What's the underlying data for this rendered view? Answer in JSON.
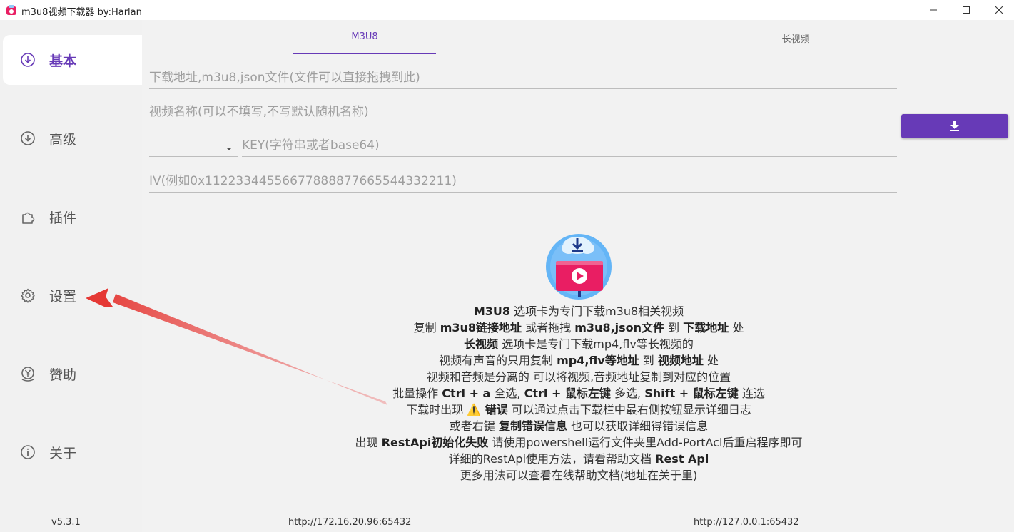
{
  "window": {
    "title": "m3u8视频下载器 by:Harlan",
    "controls": {
      "minimize": "—",
      "maximize": "☐",
      "close": "✕"
    }
  },
  "sidebar": {
    "items": [
      {
        "label": "基本",
        "icon": "download-circle-icon",
        "active": true
      },
      {
        "label": "高级",
        "icon": "download-circle-icon",
        "active": false
      },
      {
        "label": "插件",
        "icon": "puzzle-icon",
        "active": false
      },
      {
        "label": "设置",
        "icon": "gear-icon",
        "active": false
      },
      {
        "label": "赞助",
        "icon": "yen-icon",
        "active": false
      },
      {
        "label": "关于",
        "icon": "info-icon",
        "active": false
      }
    ],
    "version": "v5.3.1"
  },
  "tabs": [
    {
      "label": "M3U8",
      "active": true
    },
    {
      "label": "长视频",
      "active": false
    }
  ],
  "form": {
    "url_placeholder": "下载地址,m3u8,json文件(文件可以直接拖拽到此)",
    "name_placeholder": "视频名称(可以不填写,不写默认随机名称)",
    "method_value": "",
    "key_placeholder": "KEY(字符串或者base64)",
    "iv_placeholder": "IV(例如0x11223344556677888877665544332211)"
  },
  "help": {
    "line1_b": "M3U8",
    "line1_t": " 选项卡为专门下载m3u8相关视频",
    "line2_t1": "复制 ",
    "line2_b1": "m3u8链接地址",
    "line2_t2": " 或者拖拽 ",
    "line2_b2": "m3u8,json文件",
    "line2_t3": " 到 ",
    "line2_b3": "下载地址",
    "line2_t4": " 处",
    "line3_b": "长视频",
    "line3_t": " 选项卡是专门下载mp4,flv等长视频的",
    "line4_t1": "视频有声音的只用复制 ",
    "line4_b1": "mp4,flv等地址",
    "line4_t2": " 到 ",
    "line4_b2": "视频地址",
    "line4_t3": " 处",
    "line5": "视频和音频是分离的 可以将视频,音频地址复制到对应的位置",
    "line6_t1": "批量操作 ",
    "line6_b1": "Ctrl + a",
    "line6_t2": " 全选, ",
    "line6_b2": "Ctrl + 鼠标左键",
    "line6_t3": " 多选, ",
    "line6_b3": "Shift + 鼠标左键",
    "line6_t4": " 连选",
    "line7_t1": "下载时出现 ",
    "line7_warn": "⚠️",
    "line7_b": " 错误",
    "line7_t2": " 可以通过点击下载栏中最右侧按钮显示详细日志",
    "line8_t1": "或者右键 ",
    "line8_b": "复制错误信息",
    "line8_t2": " 也可以获取详细得错误信息",
    "line9_t1": "出现 ",
    "line9_b": "RestApi初始化失败",
    "line9_t2": " 请使用powershell运行文件夹里Add-PortAcl后重启程序即可",
    "line10_t": "详细的RestApi使用方法，请看帮助文档 ",
    "line10_b": "Rest Api",
    "line11": "更多用法可以查看在线帮助文档(地址在关于里)"
  },
  "footer": {
    "url_left": "http://172.16.20.96:65432",
    "url_right": "http://127.0.0.1:65432"
  },
  "colors": {
    "accent": "#673ab7",
    "sidebar_bg": "#f1f1f1",
    "main_bg": "#f2f2f2",
    "annotation_arrow": "#e53935"
  }
}
